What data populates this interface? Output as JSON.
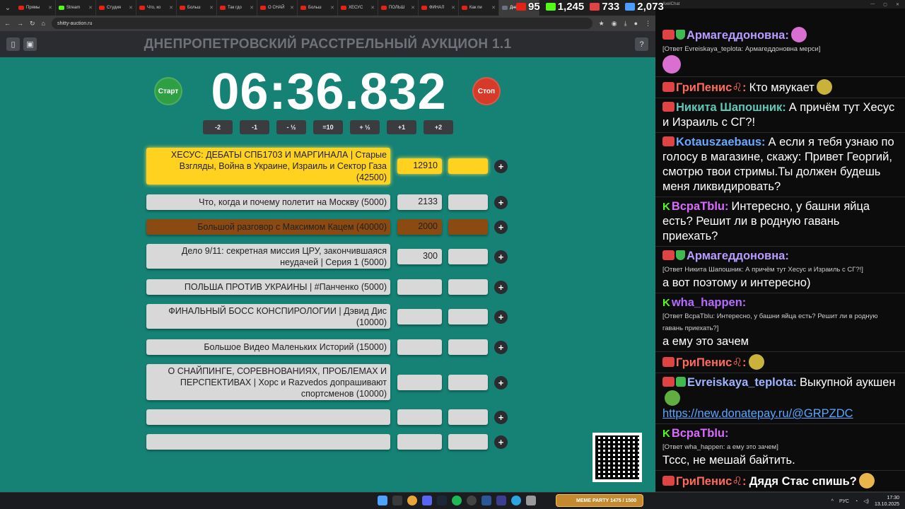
{
  "browser": {
    "tabs": [
      {
        "label": "Прямы",
        "fav": "youtube"
      },
      {
        "label": "Stream",
        "fav": "kick"
      },
      {
        "label": "Студия",
        "fav": "youtube"
      },
      {
        "label": "Что, ко",
        "fav": "youtube"
      },
      {
        "label": "Больш",
        "fav": "youtube"
      },
      {
        "label": "Так гдо",
        "fav": "youtube"
      },
      {
        "label": "О СНАЙ",
        "fav": "youtube"
      },
      {
        "label": "Больш",
        "fav": "youtube"
      },
      {
        "label": "ХЕСУС",
        "fav": "youtube"
      },
      {
        "label": "ПОЛЬШ",
        "fav": "youtube"
      },
      {
        "label": "ФИНАЛ",
        "fav": "youtube"
      },
      {
        "label": "Как пи",
        "fav": "youtube"
      },
      {
        "label": "Днеп",
        "fav": "site"
      }
    ],
    "url": "shitty-auction.ru"
  },
  "stats": [
    {
      "value": "95",
      "color": "#e62117"
    },
    {
      "value": "1,245",
      "color": "#53fc18"
    },
    {
      "value": "733",
      "color": "#e04343"
    },
    {
      "value": "2,073",
      "color": "#4a9eff"
    }
  ],
  "app": {
    "title": "ДНЕПРОПЕТРОВСКИЙ РАССТРЕЛЬНЫЙ АУКЦИОН 1.1",
    "start_label": "Старт",
    "stop_label": "Стоп",
    "timer": "06:36.832",
    "adjust_buttons": [
      "-2",
      "-1",
      "- ½",
      "=10",
      "+ ½",
      "+1",
      "+2"
    ],
    "plus_label": "+",
    "lots": [
      {
        "name": "ХЕСУС: ДЕБАТЫ СПБ1703 И МАРГИНАЛА | Старые Взгляды, Война в Украине, Израиль и Сектор Газа (42500)",
        "amount": "12910",
        "style": "yellow"
      },
      {
        "name": "Что, когда и почему полетит на Москву (5000)",
        "amount": "2133",
        "style": "normal"
      },
      {
        "name": "Большой разговор с Максимом Кацем (40000)",
        "amount": "2000",
        "style": "brown"
      },
      {
        "name": "Дело 9/11: секретная миссия ЦРУ, закончившаяся неудачей | Серия 1 (5000)",
        "amount": "300",
        "style": "normal"
      },
      {
        "name": "ПОЛЬША ПРОТИВ УКРАИНЫ | #Панченко (5000)",
        "amount": "",
        "style": "normal"
      },
      {
        "name": "ФИНАЛЬНЫЙ БОСС КОНСПИРОЛОГИИ | Дэвид Дис (10000)",
        "amount": "",
        "style": "normal"
      },
      {
        "name": "Большое Видео Маленьких Историй (15000)",
        "amount": "",
        "style": "normal"
      },
      {
        "name": "О СНАЙПИНГЕ, СОРЕВНОВАНИЯХ, ПРОБЛЕМАХ И ПЕРСПЕКТИВАХ | Хорс и Razvedos допрашивают спортсменов (10000)",
        "amount": "",
        "style": "normal"
      },
      {
        "name": "",
        "amount": "",
        "style": "normal"
      },
      {
        "name": "",
        "amount": "",
        "style": "normal"
      }
    ]
  },
  "chat": {
    "window_title": "AxelChat",
    "messages": [
      {
        "badges": [
          "live",
          "shield"
        ],
        "nick": "Армагеддоновна:",
        "nick_color": "#b89cff",
        "reply": "[Ответ Evreiskaya_teplota: Армагеддоновна мерси]",
        "text": "",
        "emote": "#d86fd1"
      },
      {
        "badges": [
          "live"
        ],
        "nick": "ГриПенис♌:",
        "nick_color": "#ff6b5b",
        "reply": "",
        "text": "Кто мяукает",
        "emote": "#c9b23a"
      },
      {
        "badges": [
          "live"
        ],
        "nick": "Никита Шапошник:",
        "nick_color": "#5fc9b8",
        "reply": "",
        "text": "А причём тут Хесус и Израиль с СГ?!",
        "emote": ""
      },
      {
        "badges": [
          "live"
        ],
        "nick": "Kotauszaebaus:",
        "nick_color": "#6aa8ff",
        "reply": "",
        "text": "А если я тебя узнаю по голосу в магазине, скажу: Привет Георгий, смотрю твои стримы.Ты должен будешь меня ликвидировать?",
        "emote": ""
      },
      {
        "badges": [
          "kick"
        ],
        "nick": "ВсраТblu:",
        "nick_color": "#d96bff",
        "reply": "",
        "text": "Интересно, у башни яйца есть? Решит ли в родную гавань приехать?",
        "emote": ""
      },
      {
        "badges": [
          "live",
          "shield"
        ],
        "nick": "Армагеддоновна:",
        "nick_color": "#b89cff",
        "reply": "[Ответ Никита Шапошник: А причём тут Хесус и Израиль с СГ?!]",
        "text": "а вот поэтому и интересно)",
        "emote": ""
      },
      {
        "badges": [
          "kick"
        ],
        "nick": "wha_happen:",
        "nick_color": "#b56bff",
        "reply": "[Ответ ВсраТblu: Интересно, у башни яйца есть? Решит ли в родную гавань приехать?]",
        "text": "а ему это зачем",
        "emote": ""
      },
      {
        "badges": [
          "live"
        ],
        "nick": "ГриПенис♌:",
        "nick_color": "#ff6b5b",
        "reply": "",
        "text": "",
        "emote": "#c9b23a"
      },
      {
        "badges": [
          "live",
          "pen"
        ],
        "nick": "Evreiskaya_teplota:",
        "nick_color": "#9fb4ff",
        "reply": "",
        "text": "Выкупной аукшен",
        "emote": "#5fae3f",
        "link": "https://new.donatepay.ru/@GRPZDC"
      },
      {
        "badges": [
          "kick"
        ],
        "nick": "ВсраТblu:",
        "nick_color": "#d96bff",
        "reply": "[Ответ wha_happen: а ему это зачем]",
        "text": "Тссс, не мешай байтить.",
        "emote": ""
      },
      {
        "badges": [
          "live"
        ],
        "nick": "ГриПенис♌:",
        "nick_color": "#ff6b5b",
        "reply": "",
        "text": "Дядя Стас спишь?",
        "emote": "#e8b64a",
        "bold": true
      }
    ]
  },
  "taskbar": {
    "widget_title": "MEME PARTY",
    "widget_sub": "1475 / 1500",
    "lang": "РУС",
    "time": "17:30",
    "date": "13.10.2025"
  }
}
